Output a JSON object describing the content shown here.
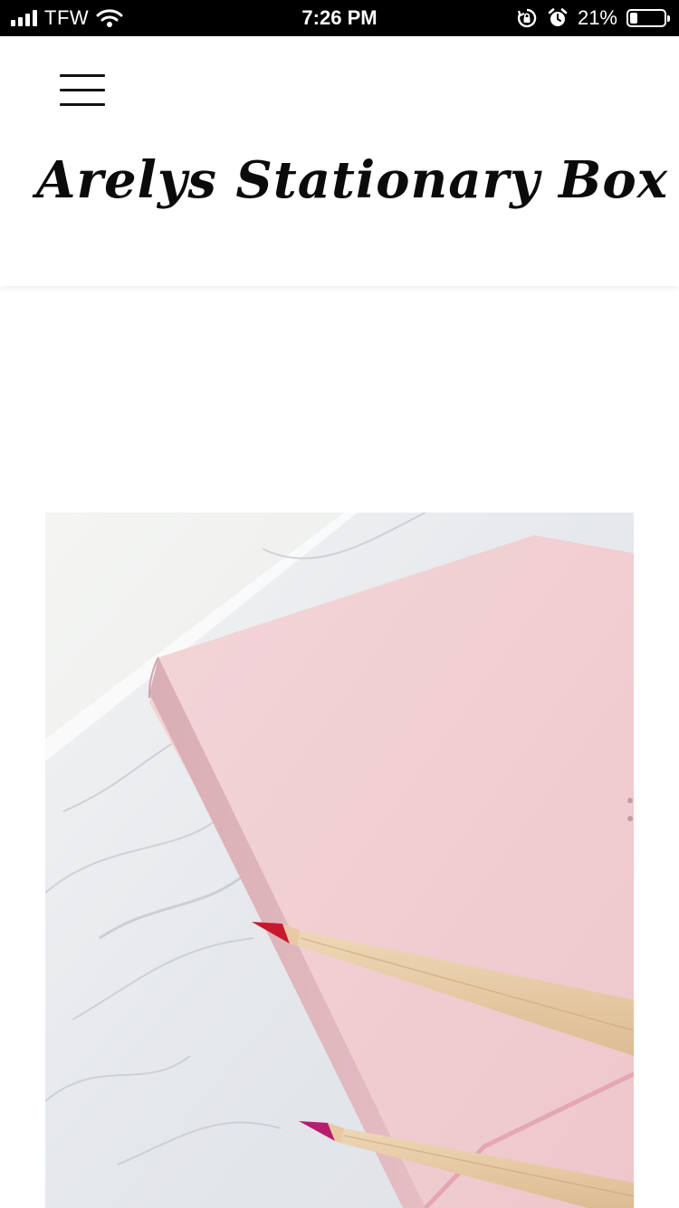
{
  "status_bar": {
    "carrier": "TFW",
    "time": "7:26 PM",
    "battery_percent": "21%",
    "battery_level": 0.21,
    "icons": [
      "signal-icon",
      "wifi-icon",
      "orientation-lock-icon",
      "alarm-icon",
      "battery-icon"
    ]
  },
  "header": {
    "menu_icon": "hamburger-menu-icon",
    "site_title": "Arelys Stationary Box"
  },
  "hero": {
    "description": "pink-notebook-with-pencils-on-marble"
  },
  "colors": {
    "status_bar_bg": "#000000",
    "page_bg": "#ffffff",
    "notebook_pink": "#f0cfd3",
    "marble": "#eceef0",
    "pencil_red": "#c8182e",
    "pencil_magenta": "#b81c6e"
  }
}
